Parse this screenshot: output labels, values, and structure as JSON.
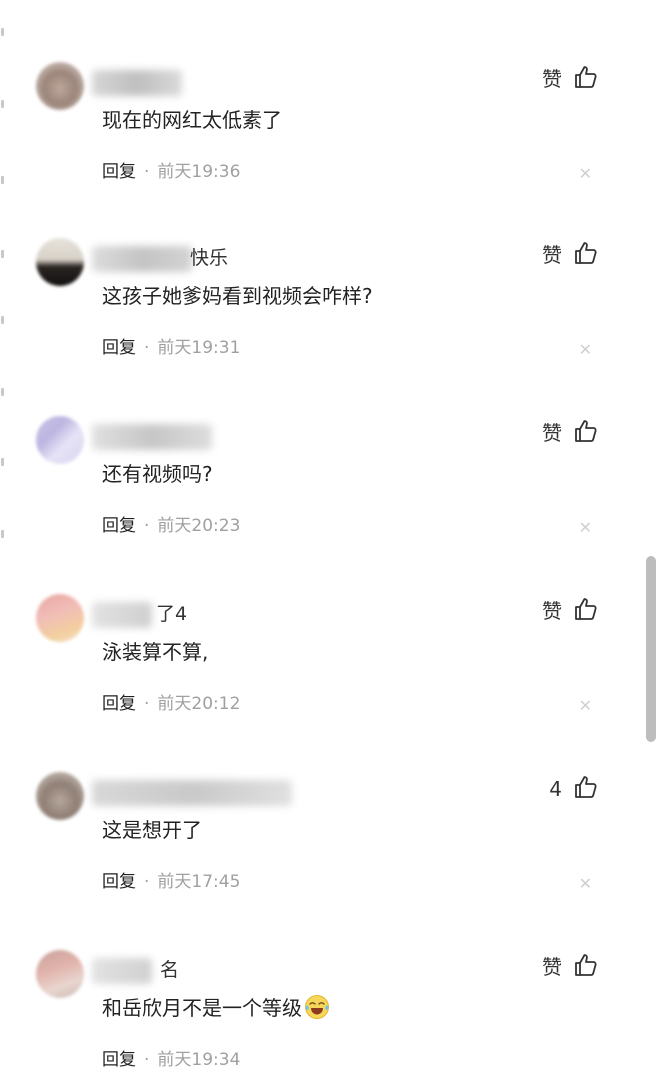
{
  "comments": [
    {
      "name": "",
      "like_label": "赞",
      "text": "现在的网红太低素了",
      "reply_label": "回复",
      "separator": "·",
      "time": "前天19:36"
    },
    {
      "name": "快乐",
      "like_label": "赞",
      "text": "这孩子她爹妈看到视频会咋样?",
      "reply_label": "回复",
      "separator": "·",
      "time": "前天19:31"
    },
    {
      "name": "",
      "like_label": "赞",
      "text": "还有视频吗?",
      "reply_label": "回复",
      "separator": "·",
      "time": "前天20:23"
    },
    {
      "name": "了4",
      "like_label": "赞",
      "text": "泳装算不算,",
      "reply_label": "回复",
      "separator": "·",
      "time": "前天20:12"
    },
    {
      "name": "",
      "like_label": "4",
      "text": "这是想开了",
      "reply_label": "回复",
      "separator": "·",
      "time": "前天17:45"
    },
    {
      "name": "名",
      "like_label": "赞",
      "text": "和岳欣月不是一个等级",
      "reply_label": "回复",
      "separator": "·",
      "time": "前天19:34"
    }
  ],
  "icons": {
    "like": "thumbs-up-icon",
    "close": "close-icon",
    "emoji": "crying-laughing-emoji-icon"
  },
  "colors": {
    "background": "#ffffff",
    "text": "#222222",
    "timestamp": "#a0a0a0",
    "close_icon": "#d0d0d0",
    "scrollbar": "#bdbdbd"
  }
}
